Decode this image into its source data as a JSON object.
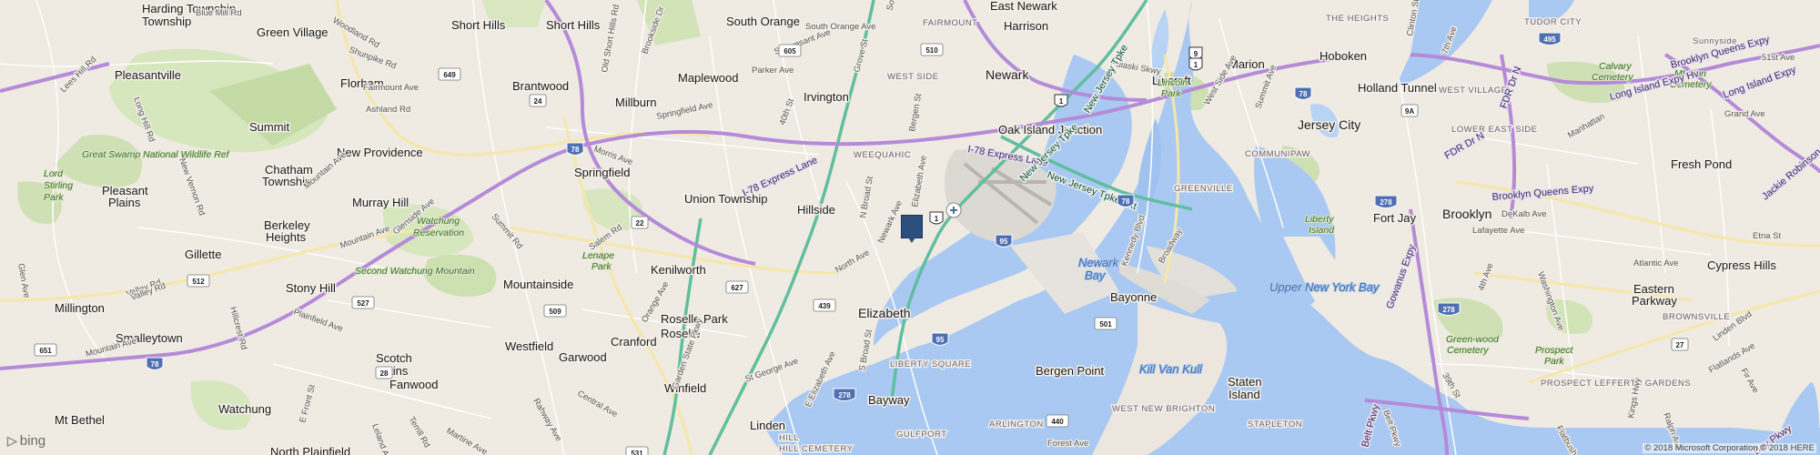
{
  "map": {
    "colors": {
      "land": "#efeae2",
      "water": "#a9c9f2",
      "park": "#cfe1b4",
      "interstate": "#b58bd9",
      "highway": "#5fbf9f",
      "pin": "#2c4f7e"
    },
    "places": [
      {
        "text": "Harding Township"
      },
      {
        "text": "Township"
      },
      {
        "text": "Green Village"
      },
      {
        "text": "Pleasantville"
      },
      {
        "text": "Short Hills"
      },
      {
        "text": "Short Hills"
      },
      {
        "text": "South Orange"
      },
      {
        "text": "East Newark"
      },
      {
        "text": "Harrison"
      },
      {
        "text": "Florham"
      },
      {
        "text": "Brantwood"
      },
      {
        "text": "Millburn"
      },
      {
        "text": "Maplewood"
      },
      {
        "text": "Irvington"
      },
      {
        "text": "Newark"
      },
      {
        "text": "Lincroft"
      },
      {
        "text": "Marion"
      },
      {
        "text": "Hoboken"
      },
      {
        "text": "Holland Tunnel"
      },
      {
        "text": "Summit"
      },
      {
        "text": "New Providence"
      },
      {
        "text": "Chatham"
      },
      {
        "text": "Township"
      },
      {
        "text": "Oak Island Junction"
      },
      {
        "text": "Jersey City"
      },
      {
        "text": "Springfield"
      },
      {
        "text": "Pleasant"
      },
      {
        "text": "Plains"
      },
      {
        "text": "Union Township"
      },
      {
        "text": "Hillside"
      },
      {
        "text": "Murray Hill"
      },
      {
        "text": "Berkeley"
      },
      {
        "text": "Heights"
      },
      {
        "text": "Gillette"
      },
      {
        "text": "Mountainside"
      },
      {
        "text": "Kenilworth"
      },
      {
        "text": "Stony Hill"
      },
      {
        "text": "Millington"
      },
      {
        "text": "Smalleytown"
      },
      {
        "text": "Roselle Park"
      },
      {
        "text": "Roselle"
      },
      {
        "text": "Elizabeth"
      },
      {
        "text": "Bayonne"
      },
      {
        "text": "Westfield"
      },
      {
        "text": "Garwood"
      },
      {
        "text": "Cranford"
      },
      {
        "text": "Scotch"
      },
      {
        "text": "Plains"
      },
      {
        "text": "Fanwood"
      },
      {
        "text": "Winfield"
      },
      {
        "text": "Linden"
      },
      {
        "text": "Bayway"
      },
      {
        "text": "Bergen Point"
      },
      {
        "text": "Staten"
      },
      {
        "text": "Island"
      },
      {
        "text": "Mt Bethel"
      },
      {
        "text": "Watchung"
      },
      {
        "text": "North Plainfield"
      },
      {
        "text": "Fort Jay"
      },
      {
        "text": "Brooklyn"
      },
      {
        "text": "Fresh Pond"
      },
      {
        "text": "Sunnyside"
      },
      {
        "text": "Cypress Hills"
      },
      {
        "text": "Eastern"
      },
      {
        "text": "Parkway"
      }
    ],
    "parks": [
      {
        "text": "Great Swamp National Wildlife Ref"
      },
      {
        "text": "Lord"
      },
      {
        "text": "Stirling"
      },
      {
        "text": "Park"
      },
      {
        "text": "Watchung"
      },
      {
        "text": "Reservation"
      },
      {
        "text": "Second Watchung Mountain"
      },
      {
        "text": "Lenape"
      },
      {
        "text": "Park"
      },
      {
        "text": "Lincoln"
      },
      {
        "text": "Park"
      },
      {
        "text": "Liberty"
      },
      {
        "text": "Island"
      },
      {
        "text": "Calvary"
      },
      {
        "text": "Cemetery"
      },
      {
        "text": "Mt Zion"
      },
      {
        "text": "Cemetery"
      },
      {
        "text": "Green-wood"
      },
      {
        "text": "Cemetery"
      },
      {
        "text": "Prospect"
      },
      {
        "text": "Park"
      }
    ],
    "water": [
      {
        "text": "Newark"
      },
      {
        "text": "Bay"
      },
      {
        "text": "Upper New York Bay"
      },
      {
        "text": "Kill Van Kull"
      }
    ],
    "areas": [
      {
        "text": "FAIRMOUNT"
      },
      {
        "text": "WEST SIDE"
      },
      {
        "text": "WEEQUAHIC"
      },
      {
        "text": "GREENVILLE"
      },
      {
        "text": "COMMUNIPAW"
      },
      {
        "text": "THE HEIGHTS"
      },
      {
        "text": "WEST VILLAGE"
      },
      {
        "text": "LOWER EAST SIDE"
      },
      {
        "text": "TUDOR CITY"
      },
      {
        "text": "BROWNSVILLE"
      },
      {
        "text": "LIBERTY SQUARE"
      },
      {
        "text": "ARLINGTON"
      },
      {
        "text": "WEST NEW BRIGHTON"
      },
      {
        "text": "STAPLETON"
      },
      {
        "text": "PROSPECT LEFFERTS GARDENS"
      },
      {
        "text": "GULFPORT"
      },
      {
        "text": "HILL"
      },
      {
        "text": "HILL CEMETERY"
      }
    ],
    "roads": [
      {
        "text": "Woodland Rd"
      },
      {
        "text": "Blue Mill Rd"
      },
      {
        "text": "Shunpike Rd"
      },
      {
        "text": "Fairmount Ave"
      },
      {
        "text": "Ashland Rd"
      },
      {
        "text": "Lees Hill Rd"
      },
      {
        "text": "Long Hill Rd"
      },
      {
        "text": "New Vernon Rd"
      },
      {
        "text": "Morris Ave"
      },
      {
        "text": "Springfield Ave"
      },
      {
        "text": "Parker Ave"
      },
      {
        "text": "Stuyvesant Ave"
      },
      {
        "text": "Old Short Hills Rd"
      },
      {
        "text": "Brookside Dr"
      },
      {
        "text": "South Orange Ave"
      },
      {
        "text": "Grove St"
      },
      {
        "text": "South Broad St"
      },
      {
        "text": "40th St"
      },
      {
        "text": "Bergen St"
      },
      {
        "text": "Elizabeth Ave"
      },
      {
        "text": "Mountain Ave"
      },
      {
        "text": "Glenside Ave"
      },
      {
        "text": "Summit Rd"
      },
      {
        "text": "Valley Rd"
      },
      {
        "text": "Hillcrest Rd"
      },
      {
        "text": "Plainfield Ave"
      },
      {
        "text": "Mountain Ave"
      },
      {
        "text": "Salem Rd"
      },
      {
        "text": "North Ave"
      },
      {
        "text": "N Broad St"
      },
      {
        "text": "Newark Ave"
      },
      {
        "text": "Orange Ave"
      },
      {
        "text": "St George Ave"
      },
      {
        "text": "E Elizabeth Ave"
      },
      {
        "text": "S Broad St"
      },
      {
        "text": "Central Ave"
      },
      {
        "text": "Rahway Ave"
      },
      {
        "text": "Terrill Rd"
      },
      {
        "text": "Leland Ave"
      },
      {
        "text": "Martine Ave"
      },
      {
        "text": "E Front St"
      },
      {
        "text": "Forest Ave"
      },
      {
        "text": "Kennedy Blvd"
      },
      {
        "text": "Broadway"
      },
      {
        "text": "West Side Ave"
      },
      {
        "text": "Summit Ave"
      },
      {
        "text": "Clinton St"
      },
      {
        "text": "7th Ave"
      },
      {
        "text": "4th Ave"
      },
      {
        "text": "Washington Ave"
      },
      {
        "text": "Flatbush Ave"
      },
      {
        "text": "Kings Hwy"
      },
      {
        "text": "Ralph Ave"
      },
      {
        "text": "Linden Blvd"
      },
      {
        "text": "Flatlands Ave"
      },
      {
        "text": "Atlantic Ave"
      },
      {
        "text": "DeKalb Ave"
      },
      {
        "text": "Lafayette Ave"
      },
      {
        "text": "Grand Ave"
      },
      {
        "text": "51st Ave"
      },
      {
        "text": "Etna St"
      },
      {
        "text": "39th St"
      },
      {
        "text": "Manhattan"
      },
      {
        "text": "Fir Ave"
      },
      {
        "text": "Valley Rd"
      },
      {
        "text": "Mountain Ave"
      },
      {
        "text": "Glen Ave"
      },
      {
        "text": "Belt Pkwy"
      },
      {
        "text": "Garden State Pkwy"
      },
      {
        "text": "Pulaski Skwy"
      }
    ],
    "highways": [
      {
        "text": "I-78 Express Lane"
      },
      {
        "text": "New Jersey Tpke"
      },
      {
        "text": "I-78 Express Lane"
      },
      {
        "text": "New Jersey Tpke"
      },
      {
        "text": "New Jersey Tpke Ext"
      },
      {
        "text": "FDR Dr N"
      },
      {
        "text": "FDR Dr N"
      },
      {
        "text": "Long Island Expy"
      },
      {
        "text": "Long Island Expy Hv"
      },
      {
        "text": "Brooklyn Queens Expy"
      },
      {
        "text": "Brooklyn Queens Expy"
      },
      {
        "text": "Gowanus Expy"
      },
      {
        "text": "Jackie Robinson Pkwy"
      },
      {
        "text": "Belt Pkwy"
      },
      {
        "text": "Bay Pkwy"
      }
    ],
    "shields": [
      {
        "text": "649"
      },
      {
        "text": "24"
      },
      {
        "text": "605"
      },
      {
        "text": "510"
      },
      {
        "text": "1"
      },
      {
        "text": "9"
      },
      {
        "text": "1"
      },
      {
        "text": "9A"
      },
      {
        "text": "78"
      },
      {
        "text": "78"
      },
      {
        "text": "1"
      },
      {
        "text": "22"
      },
      {
        "text": "95"
      },
      {
        "text": "78"
      },
      {
        "text": "512"
      },
      {
        "text": "527"
      },
      {
        "text": "509"
      },
      {
        "text": "627"
      },
      {
        "text": "439"
      },
      {
        "text": "501"
      },
      {
        "text": "651"
      },
      {
        "text": "78"
      },
      {
        "text": "28"
      },
      {
        "text": "95"
      },
      {
        "text": "278"
      },
      {
        "text": "440"
      },
      {
        "text": "278"
      },
      {
        "text": "278"
      },
      {
        "text": "495"
      },
      {
        "text": "27"
      },
      {
        "text": "531"
      }
    ],
    "brand": "bing",
    "copyright": "© 2018 Microsoft Corporation © 2018 HERE"
  }
}
